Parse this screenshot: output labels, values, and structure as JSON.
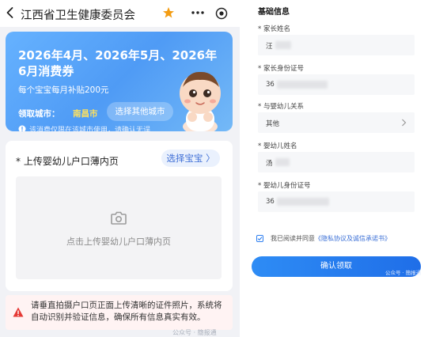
{
  "left": {
    "header": {
      "title": "江西省卫生健康委员会"
    },
    "banner": {
      "title": "2026年4月、2026年5月、2026年6月消费券",
      "subtitle": "每个宝宝每月补贴200元",
      "city_label": "领取城市：",
      "city_value": "南昌市",
      "other_city_button": "选择其他城市",
      "notice": "该消费仅限在该城市使用，请确认无误"
    },
    "upload": {
      "label": "* 上传婴幼儿户口薄内页",
      "choose_baby_button": "选择宝宝 〉",
      "hint": "点击上传婴幼儿户口薄内页"
    },
    "tip": {
      "text": "请垂直拍摄户口页正面上传清晰的证件照片，系统将自动识别并验证信息，确保所有信息真实有效。"
    },
    "watermark": "公众号 · 簡报通"
  },
  "right": {
    "section_title": "基础信息",
    "fields": [
      {
        "label": "* 家长姓名",
        "value": "汪"
      },
      {
        "label": "* 家长身份证号",
        "value": "36"
      },
      {
        "label": "* 与婴幼儿关系",
        "value": "其他"
      },
      {
        "label": "* 婴幼儿姓名",
        "value": "汤"
      },
      {
        "label": "* 婴幼儿身份证号",
        "value": "36"
      }
    ],
    "agreement": {
      "prefix": "我已阅读并同意",
      "link": "《隐私协议及诚信承诺书》"
    },
    "confirm_button": "确认领取",
    "watermark": "公众号 · 簡报通"
  },
  "colors": {
    "accent": "#1f6ee8",
    "banner_blue": "#5aa6f8",
    "city_highlight": "#ffe15e",
    "warning_red": "#e53935",
    "star": "#f39c12"
  }
}
